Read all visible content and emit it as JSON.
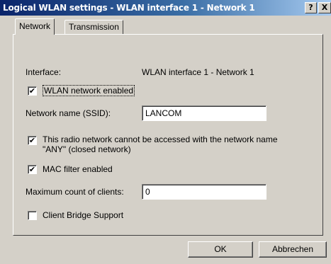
{
  "window": {
    "title": "Logical WLAN settings - WLAN interface 1 - Network 1",
    "help_label": "?",
    "close_label": "X"
  },
  "tabs": [
    {
      "label": "Network",
      "selected": true
    },
    {
      "label": "Transmission",
      "selected": false
    }
  ],
  "network": {
    "interface_label": "Interface:",
    "interface_value": "WLAN interface 1 - Network 1",
    "wlan_enabled": {
      "label": "WLAN network enabled",
      "checked": true
    },
    "ssid": {
      "label": "Network name (SSID):",
      "value": "LANCOM"
    },
    "closed_network": {
      "label_line1": "This radio network cannot be accessed with the network name",
      "label_line2": "\"ANY\" (closed network)",
      "checked": true
    },
    "mac_filter": {
      "label": "MAC filter enabled",
      "checked": true
    },
    "max_clients": {
      "label": "Maximum count of clients:",
      "value": "0"
    },
    "client_bridge": {
      "label": "Client Bridge Support",
      "checked": false
    }
  },
  "footer": {
    "ok_label": "OK",
    "cancel_label": "Abbrechen"
  },
  "colors": {
    "title_gradient_start": "#0a246a",
    "title_gradient_end": "#a6caf0",
    "face": "#d4d0c8"
  }
}
